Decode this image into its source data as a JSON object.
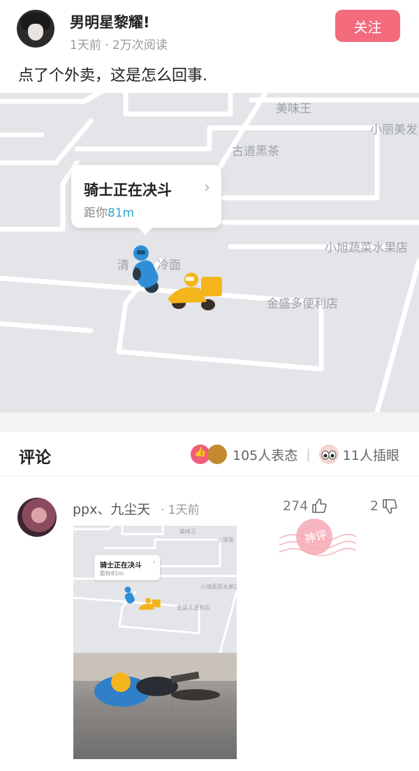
{
  "post": {
    "author": "男明星黎耀!",
    "meta": "1天前 · 2万次阅读",
    "follow_label": "关注",
    "text": "点了个外卖，这是怎么回事."
  },
  "map": {
    "labels": {
      "l1": "美味王",
      "l2": "小丽美发",
      "l3": "古道黑茶",
      "l4": "小旭蔬菜水果店",
      "l5": "清",
      "l6": "冷面",
      "l7": "金盛多便利店"
    },
    "card": {
      "title": "骑士正在决斗",
      "distance_prefix": "距你",
      "distance_value": "81m"
    }
  },
  "comments_section": {
    "title": "评论",
    "reactions_text": "105人表态",
    "eyes_text": "11人插眼"
  },
  "comment": {
    "author": "ppx、九尘天",
    "time": "· 1天前",
    "likes": "274",
    "dislikes": "2",
    "stamp_text": "神评",
    "mini_map": {
      "card_title": "骑士正在决斗",
      "card_distance": "距你81m",
      "l1": "美味王",
      "l2": "小丽美",
      "l3": "小旭蔬菜水果店",
      "l4": "金盛多便利店"
    }
  },
  "colors": {
    "accent": "#f36b7d",
    "distance": "#2aa8c9",
    "map_bg": "#e4e5e8",
    "rider_blue": "#2e8fd8",
    "rider_yellow": "#f4b51c"
  },
  "icons": [
    "user-avatar",
    "chevron-right-icon",
    "like-emoji-icon",
    "hat-emoji-icon",
    "eyes-emoji-icon",
    "thumb-up-icon",
    "thumb-down-icon",
    "god-comment-stamp"
  ]
}
